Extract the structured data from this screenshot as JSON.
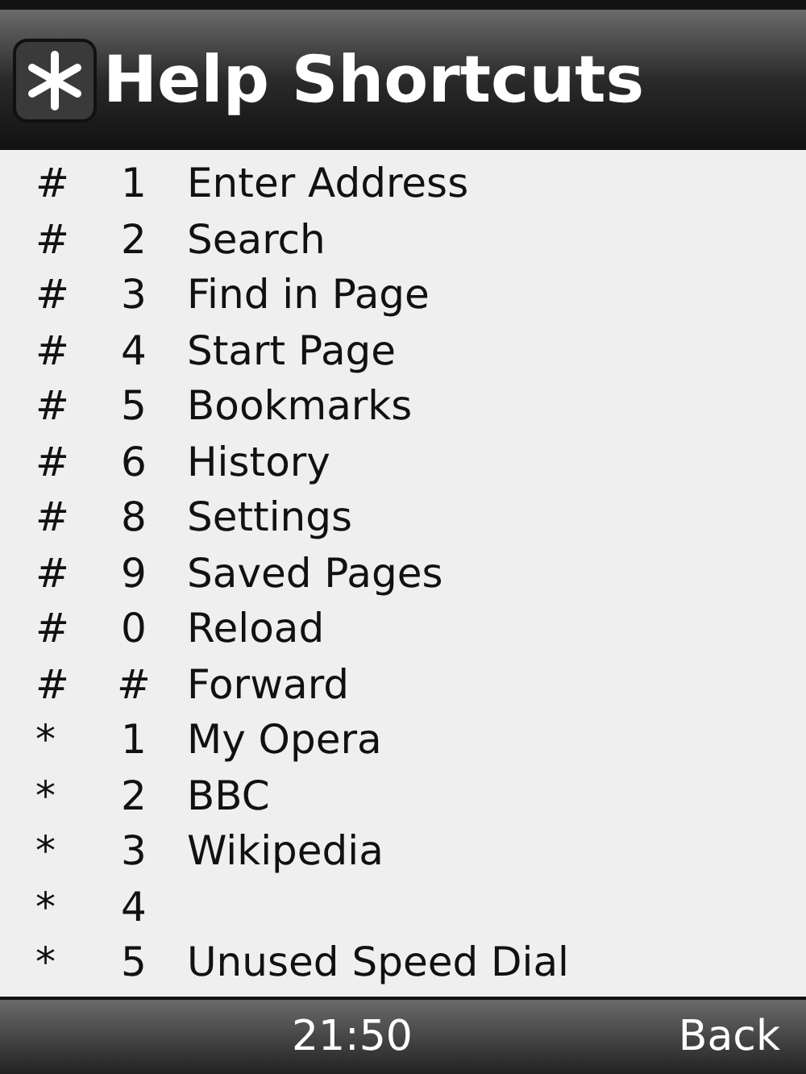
{
  "header": {
    "title": "Help Shortcuts"
  },
  "shortcuts": [
    {
      "prefix": "#",
      "key": "1",
      "label": "Enter Address"
    },
    {
      "prefix": "#",
      "key": "2",
      "label": "Search"
    },
    {
      "prefix": "#",
      "key": "3",
      "label": "Find in Page"
    },
    {
      "prefix": "#",
      "key": "4",
      "label": "Start Page"
    },
    {
      "prefix": "#",
      "key": "5",
      "label": "Bookmarks"
    },
    {
      "prefix": "#",
      "key": "6",
      "label": "History"
    },
    {
      "prefix": "#",
      "key": "8",
      "label": "Settings"
    },
    {
      "prefix": "#",
      "key": "9",
      "label": "Saved Pages"
    },
    {
      "prefix": "#",
      "key": "0",
      "label": "Reload"
    },
    {
      "prefix": "#",
      "key": "#",
      "label": "Forward"
    },
    {
      "prefix": "*",
      "key": "1",
      "label": "My Opera"
    },
    {
      "prefix": "*",
      "key": "2",
      "label": "BBC"
    },
    {
      "prefix": "*",
      "key": "3",
      "label": "Wikipedia"
    },
    {
      "prefix": "*",
      "key": "4"
    },
    {
      "prefix": "*",
      "key": "5",
      "label": "Unused Speed Dial"
    }
  ],
  "status_bar": {
    "time": "21:50",
    "right_softkey": "Back"
  }
}
